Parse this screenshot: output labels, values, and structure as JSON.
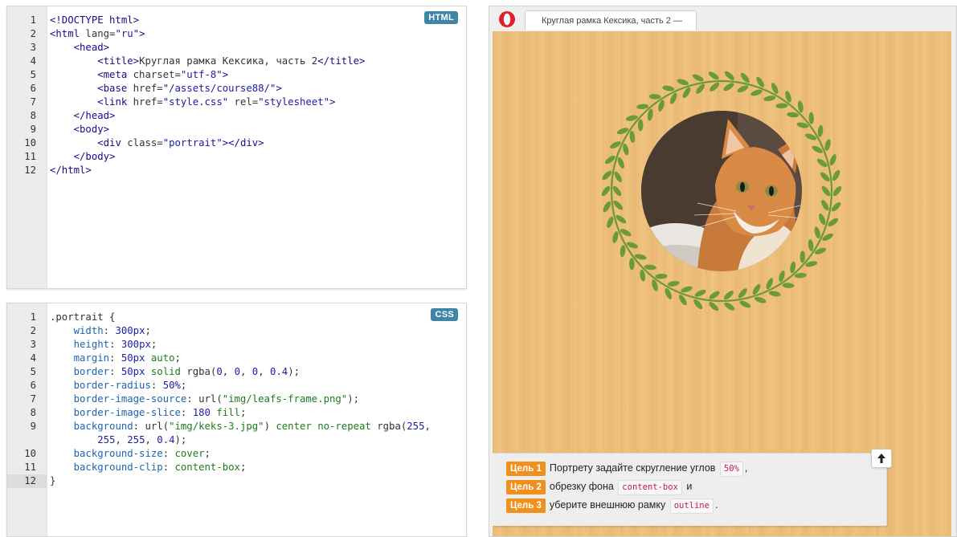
{
  "html_editor": {
    "badge": "HTML",
    "lines": [
      {
        "n": "1",
        "parts": [
          [
            "tag",
            "<!DOCTYPE html>"
          ]
        ]
      },
      {
        "n": "2",
        "parts": [
          [
            "tag",
            "<html "
          ],
          [
            "attr",
            "lang"
          ],
          [
            "plain",
            "="
          ],
          [
            "str",
            "\"ru\""
          ],
          [
            "tag",
            ">"
          ]
        ]
      },
      {
        "n": "3",
        "parts": [
          [
            "plain",
            "    "
          ],
          [
            "tag",
            "<head>"
          ]
        ]
      },
      {
        "n": "4",
        "parts": [
          [
            "plain",
            "        "
          ],
          [
            "tag",
            "<title>"
          ],
          [
            "plain",
            "Круглая рамка Кексика, часть 2"
          ],
          [
            "tag",
            "</title>"
          ]
        ]
      },
      {
        "n": "5",
        "parts": [
          [
            "plain",
            "        "
          ],
          [
            "tag",
            "<meta "
          ],
          [
            "attr",
            "charset"
          ],
          [
            "plain",
            "="
          ],
          [
            "str",
            "\"utf-8\""
          ],
          [
            "tag",
            ">"
          ]
        ]
      },
      {
        "n": "6",
        "parts": [
          [
            "plain",
            "        "
          ],
          [
            "tag",
            "<base "
          ],
          [
            "attr",
            "href"
          ],
          [
            "plain",
            "="
          ],
          [
            "str",
            "\"/assets/course88/\""
          ],
          [
            "tag",
            ">"
          ]
        ]
      },
      {
        "n": "7",
        "parts": [
          [
            "plain",
            "        "
          ],
          [
            "tag",
            "<link "
          ],
          [
            "attr",
            "href"
          ],
          [
            "plain",
            "="
          ],
          [
            "str",
            "\"style.css\""
          ],
          [
            "plain",
            " "
          ],
          [
            "attr",
            "rel"
          ],
          [
            "plain",
            "="
          ],
          [
            "str",
            "\"stylesheet\""
          ],
          [
            "tag",
            ">"
          ]
        ]
      },
      {
        "n": "8",
        "parts": [
          [
            "plain",
            "    "
          ],
          [
            "tag",
            "</head>"
          ]
        ]
      },
      {
        "n": "9",
        "parts": [
          [
            "plain",
            "    "
          ],
          [
            "tag",
            "<body>"
          ]
        ]
      },
      {
        "n": "10",
        "parts": [
          [
            "plain",
            "        "
          ],
          [
            "tag",
            "<div "
          ],
          [
            "attr",
            "class"
          ],
          [
            "plain",
            "="
          ],
          [
            "str",
            "\"portrait\""
          ],
          [
            "tag",
            "></div>"
          ]
        ]
      },
      {
        "n": "11",
        "parts": [
          [
            "plain",
            "    "
          ],
          [
            "tag",
            "</body>"
          ]
        ]
      },
      {
        "n": "12",
        "parts": [
          [
            "tag",
            "</html>"
          ]
        ]
      }
    ]
  },
  "css_editor": {
    "badge": "CSS",
    "lines": [
      {
        "n": "1",
        "parts": [
          [
            "plain",
            ".portrait {"
          ]
        ]
      },
      {
        "n": "2",
        "parts": [
          [
            "plain",
            "    "
          ],
          [
            "prop",
            "width"
          ],
          [
            "plain",
            ": "
          ],
          [
            "num",
            "300px"
          ],
          [
            "plain",
            ";"
          ]
        ]
      },
      {
        "n": "3",
        "parts": [
          [
            "plain",
            "    "
          ],
          [
            "prop",
            "height"
          ],
          [
            "plain",
            ": "
          ],
          [
            "num",
            "300px"
          ],
          [
            "plain",
            ";"
          ]
        ]
      },
      {
        "n": "4",
        "parts": [
          [
            "plain",
            "    "
          ],
          [
            "prop",
            "margin"
          ],
          [
            "plain",
            ": "
          ],
          [
            "num",
            "50px"
          ],
          [
            "plain",
            " "
          ],
          [
            "val",
            "auto"
          ],
          [
            "plain",
            ";"
          ]
        ]
      },
      {
        "n": "5",
        "parts": [
          [
            "plain",
            "    "
          ],
          [
            "prop",
            "border"
          ],
          [
            "plain",
            ": "
          ],
          [
            "num",
            "50px"
          ],
          [
            "plain",
            " "
          ],
          [
            "val",
            "solid"
          ],
          [
            "plain",
            " rgba("
          ],
          [
            "num",
            "0"
          ],
          [
            "plain",
            ", "
          ],
          [
            "num",
            "0"
          ],
          [
            "plain",
            ", "
          ],
          [
            "num",
            "0"
          ],
          [
            "plain",
            ", "
          ],
          [
            "num",
            "0.4"
          ],
          [
            "plain",
            ");"
          ]
        ]
      },
      {
        "n": "6",
        "parts": [
          [
            "plain",
            "    "
          ],
          [
            "prop",
            "border-radius"
          ],
          [
            "plain",
            ": "
          ],
          [
            "num",
            "50%"
          ],
          [
            "plain",
            ";"
          ]
        ]
      },
      {
        "n": "7",
        "parts": [
          [
            "plain",
            "    "
          ],
          [
            "prop",
            "border-image-source"
          ],
          [
            "plain",
            ": url("
          ],
          [
            "val",
            "\"img/leafs-frame.png\""
          ],
          [
            "plain",
            ");"
          ]
        ]
      },
      {
        "n": "8",
        "parts": [
          [
            "plain",
            "    "
          ],
          [
            "prop",
            "border-image-slice"
          ],
          [
            "plain",
            ": "
          ],
          [
            "num",
            "180"
          ],
          [
            "plain",
            " "
          ],
          [
            "val",
            "fill"
          ],
          [
            "plain",
            ";"
          ]
        ]
      },
      {
        "n": "9",
        "parts": [
          [
            "plain",
            "    "
          ],
          [
            "prop",
            "background"
          ],
          [
            "plain",
            ": url("
          ],
          [
            "val",
            "\"img/keks-3.jpg\""
          ],
          [
            "plain",
            ") "
          ],
          [
            "val",
            "center no-repeat"
          ],
          [
            "plain",
            " rgba("
          ],
          [
            "num",
            "255"
          ],
          [
            "plain",
            ","
          ]
        ]
      },
      {
        "n": "",
        "parts": [
          [
            "plain",
            "        "
          ],
          [
            "num",
            "255"
          ],
          [
            "plain",
            ", "
          ],
          [
            "num",
            "255"
          ],
          [
            "plain",
            ", "
          ],
          [
            "num",
            "0.4"
          ],
          [
            "plain",
            ");"
          ]
        ]
      },
      {
        "n": "10",
        "parts": [
          [
            "plain",
            "    "
          ],
          [
            "prop",
            "background-size"
          ],
          [
            "plain",
            ": "
          ],
          [
            "val",
            "cover"
          ],
          [
            "plain",
            ";"
          ]
        ]
      },
      {
        "n": "11",
        "parts": [
          [
            "plain",
            "    "
          ],
          [
            "prop",
            "background-clip"
          ],
          [
            "plain",
            ": "
          ],
          [
            "val",
            "content-box"
          ],
          [
            "plain",
            ";"
          ]
        ]
      },
      {
        "n": "12",
        "parts": [
          [
            "plain",
            "}"
          ]
        ],
        "active": true
      }
    ]
  },
  "browser": {
    "tab_title": "Круглая рамка Кексика, часть 2 —",
    "logo_color": "#e0202a",
    "background_color": "#f1c27f",
    "leaf_color": "#6b9a38"
  },
  "tasks": [
    {
      "goal": "Цель 1",
      "before": "Портрету задайте скругление углов",
      "code": "50%",
      "after": ","
    },
    {
      "goal": "Цель 2",
      "before": "обрезку фона",
      "code": "content-box",
      "after": "и"
    },
    {
      "goal": "Цель 3",
      "before": "уберите внешнюю рамку",
      "code": "outline",
      "after": "."
    }
  ],
  "icons": {
    "scroll_up": "arrow-up-icon",
    "browser_logo": "opera-logo-icon"
  }
}
